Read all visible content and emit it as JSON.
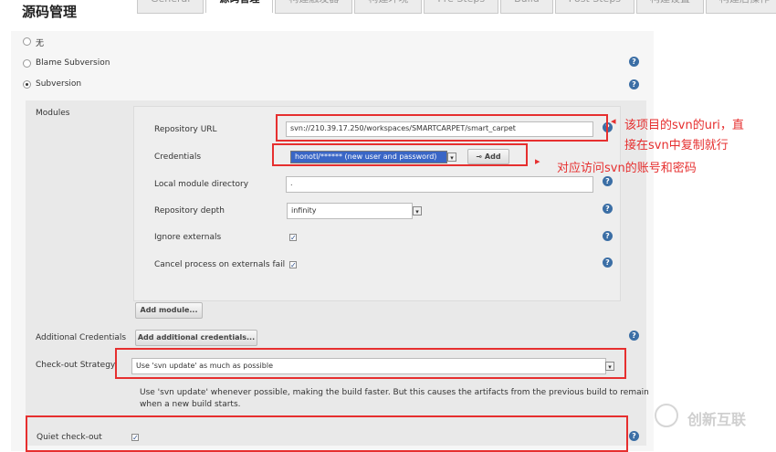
{
  "page_title": "源码管理",
  "tabs": [
    "General",
    "源码管理",
    "构建触发器",
    "构建环境",
    "Pre Steps",
    "Build",
    "Post Steps",
    "构建设置",
    "构建后操作"
  ],
  "scm_options": {
    "none_label": "无",
    "blame_label": "Blame Subversion",
    "svn_label": "Subversion",
    "selected": "Subversion"
  },
  "modules": {
    "label": "Modules",
    "repository_url_label": "Repository URL",
    "repository_url_value": "svn://210.39.17.250/workspaces/SMARTCARPET/smart_carpet",
    "credentials_label": "Credentials",
    "credentials_value": "honotl/****** (new user and password)",
    "add_button": "Add",
    "local_dir_label": "Local module directory",
    "local_dir_value": ".",
    "depth_label": "Repository depth",
    "depth_value": "infinity",
    "ignore_externals_label": "Ignore externals",
    "ignore_externals_checked": true,
    "cancel_externals_label": "Cancel process on externals fail",
    "cancel_externals_checked": true,
    "add_module_button": "Add module..."
  },
  "additional_credentials": {
    "label": "Additional Credentials",
    "button": "Add additional credentials..."
  },
  "checkout_strategy": {
    "label": "Check-out Strategy",
    "value": "Use 'svn update' as much as possible",
    "description_line1": "Use 'svn update' whenever possible, making the build faster. But this causes the artifacts from the previous build to remain",
    "description_line2": "when a new build starts."
  },
  "quiet_checkout": {
    "label": "Quiet check-out",
    "checked": true
  },
  "annotations": {
    "url_note_line1": "该项目的svn的uri，直",
    "url_note_line2": "接在svn中复制就行",
    "credentials_note": "对应访问svn的账号和密码",
    "annotation_color": "#e62f2f"
  },
  "watermark": "创新互联"
}
